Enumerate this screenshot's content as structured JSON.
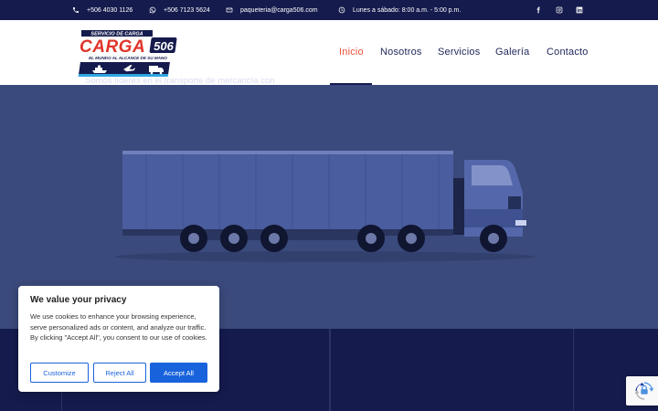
{
  "topbar": {
    "phone": "+506 4030 1126",
    "whatsapp": "+506 7123 5624",
    "email": "paqueteria@carga506.com",
    "hours": "Lunes a sábado: 8:00 a.m. - 5:00 p.m."
  },
  "logo": {
    "top_text": "SERVICIO DE CARGA",
    "brand": "CARGA",
    "number": "506",
    "tagline": "EL MUNDO AL ALCANCE DE SU MANO"
  },
  "nav": {
    "items": [
      "Inicio",
      "Nosotros",
      "Servicios",
      "Galería",
      "Contacto"
    ],
    "active_index": 0
  },
  "band": {
    "text": "Somos líderes en el transporte de mercancía con"
  },
  "cookie": {
    "title": "We value your privacy",
    "body": "We use cookies to enhance your browsing experience, serve personalized ads or content, and analyze our traffic. By clicking \"Accept All\", you consent to our use of cookies.",
    "customize": "Customize",
    "reject": "Reject All",
    "accept": "Accept All"
  },
  "colors": {
    "navy": "#151b4d",
    "hero": "#3b4a7c",
    "accent": "#e8533a",
    "button_blue": "#1863dc"
  },
  "icons": [
    "phone-icon",
    "whatsapp-icon",
    "email-icon",
    "clock-icon",
    "facebook-icon",
    "instagram-icon",
    "linkedin-icon",
    "recaptcha-icon"
  ]
}
